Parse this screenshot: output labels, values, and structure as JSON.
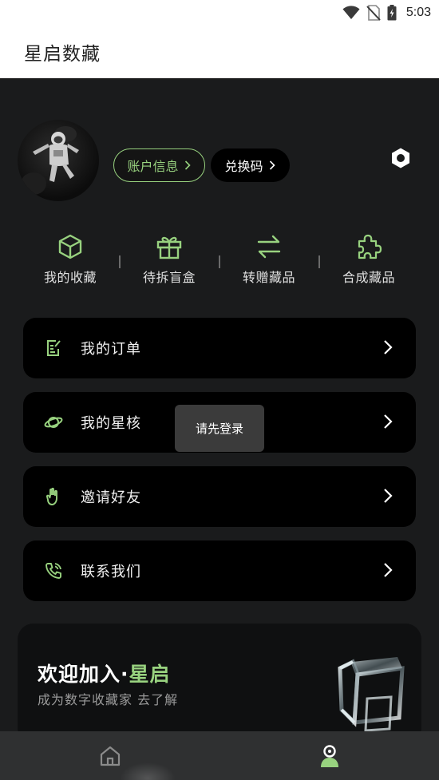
{
  "status_bar": {
    "time": "5:03",
    "icons": [
      "wifi-icon",
      "no-sim-icon",
      "battery-icon"
    ]
  },
  "app_bar": {
    "title": "星启数藏"
  },
  "profile": {
    "avatar": "astronaut-avatar",
    "account_button": "账户信息",
    "redeem_button": "兑换码",
    "settings_icon": "settings-icon"
  },
  "quick_actions": [
    {
      "label": "我的收藏",
      "icon": "box-icon"
    },
    {
      "label": "待拆盲盒",
      "icon": "gift-icon"
    },
    {
      "label": "转赠藏品",
      "icon": "transfer-icon"
    },
    {
      "label": "合成藏品",
      "icon": "puzzle-icon"
    }
  ],
  "menu": [
    {
      "label": "我的订单",
      "icon": "order-icon"
    },
    {
      "label": "我的星核",
      "icon": "planet-icon"
    },
    {
      "label": "邀请好友",
      "icon": "hand-icon"
    },
    {
      "label": "联系我们",
      "icon": "phone-icon"
    }
  ],
  "toast": {
    "text": "请先登录"
  },
  "welcome": {
    "title_prefix": "欢迎加入",
    "title_dot": "·",
    "title_accent": "星启",
    "subtitle": "成为数字收藏家 去了解"
  },
  "bottom_nav": [
    {
      "name": "home",
      "icon": "home-icon"
    },
    {
      "name": "profile",
      "icon": "user-icon"
    }
  ],
  "colors": {
    "accent": "#98d27f",
    "background": "#1a1b1c",
    "card": "#000000"
  }
}
